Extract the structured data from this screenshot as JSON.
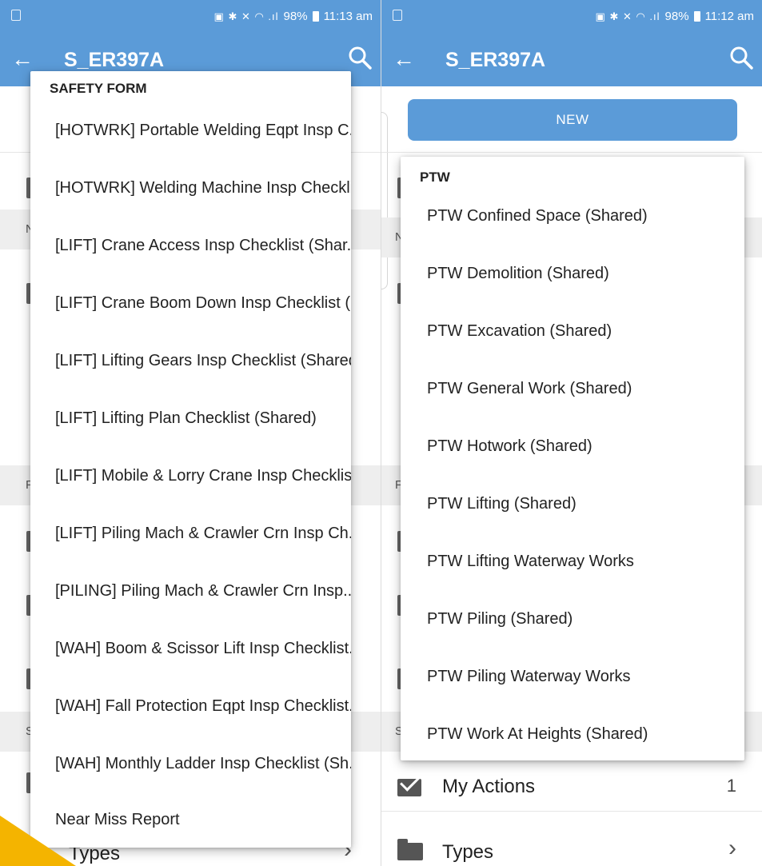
{
  "left": {
    "status": {
      "icons": "▣ ✱ ✕ ◠ .ıl",
      "battery_pct": "98%",
      "time": "11:13 am"
    },
    "appbar": {
      "back": "←",
      "title": "S_ER397A",
      "search_icon": "search-icon"
    },
    "menu": {
      "header": "SAFETY FORM",
      "items": [
        "[HOTWRK] Portable Welding Eqpt Insp C...",
        "[HOTWRK] Welding Machine Insp Checkli...",
        "[LIFT] Crane Access Insp Checklist (Shar...",
        "[LIFT] Crane Boom Down Insp Checklist (...",
        "[LIFT] Lifting Gears Insp Checklist (Shared)",
        "[LIFT] Lifting Plan Checklist (Shared)",
        "[LIFT] Mobile & Lorry Crane Insp Checklis...",
        "[LIFT] Piling Mach & Crawler Crn Insp Ch...",
        "[PILING] Piling Mach & Crawler Crn Insp...",
        "[WAH] Boom & Scissor Lift Insp Checklist...",
        "[WAH] Fall Protection Eqpt Insp Checklist...",
        "[WAH] Monthly Ladder Insp Checklist (Sh...",
        "Near Miss Report"
      ]
    },
    "under": {
      "types_label": "Types",
      "chev": "›",
      "sec_n": "N",
      "sec_f": "F",
      "sec_s": "S"
    }
  },
  "right": {
    "status": {
      "icons": "▣ ✱ ✕ ◠ .ıl",
      "battery_pct": "98%",
      "time": "11:12 am"
    },
    "appbar": {
      "back": "←",
      "title": "S_ER397A",
      "search_icon": "search-icon"
    },
    "new_button": "NEW",
    "menu": {
      "header": "PTW",
      "items": [
        "PTW Confined Space (Shared)",
        "PTW Demolition (Shared)",
        "PTW Excavation (Shared)",
        "PTW General Work (Shared)",
        "PTW Hotwork (Shared)",
        "PTW Lifting (Shared)",
        "PTW Lifting Waterway Works",
        "PTW Piling (Shared)",
        "PTW Piling Waterway Works",
        "PTW Work At Heights (Shared)"
      ]
    },
    "under": {
      "my_actions_label": "My Actions",
      "my_actions_count": "1",
      "types_label": "Types",
      "chev": "›",
      "sec_n": "N",
      "sec_f": "F",
      "sec_s": "S"
    }
  },
  "colors": {
    "appbar": "#5b9bd8",
    "accent_corner": "#f4b400"
  }
}
